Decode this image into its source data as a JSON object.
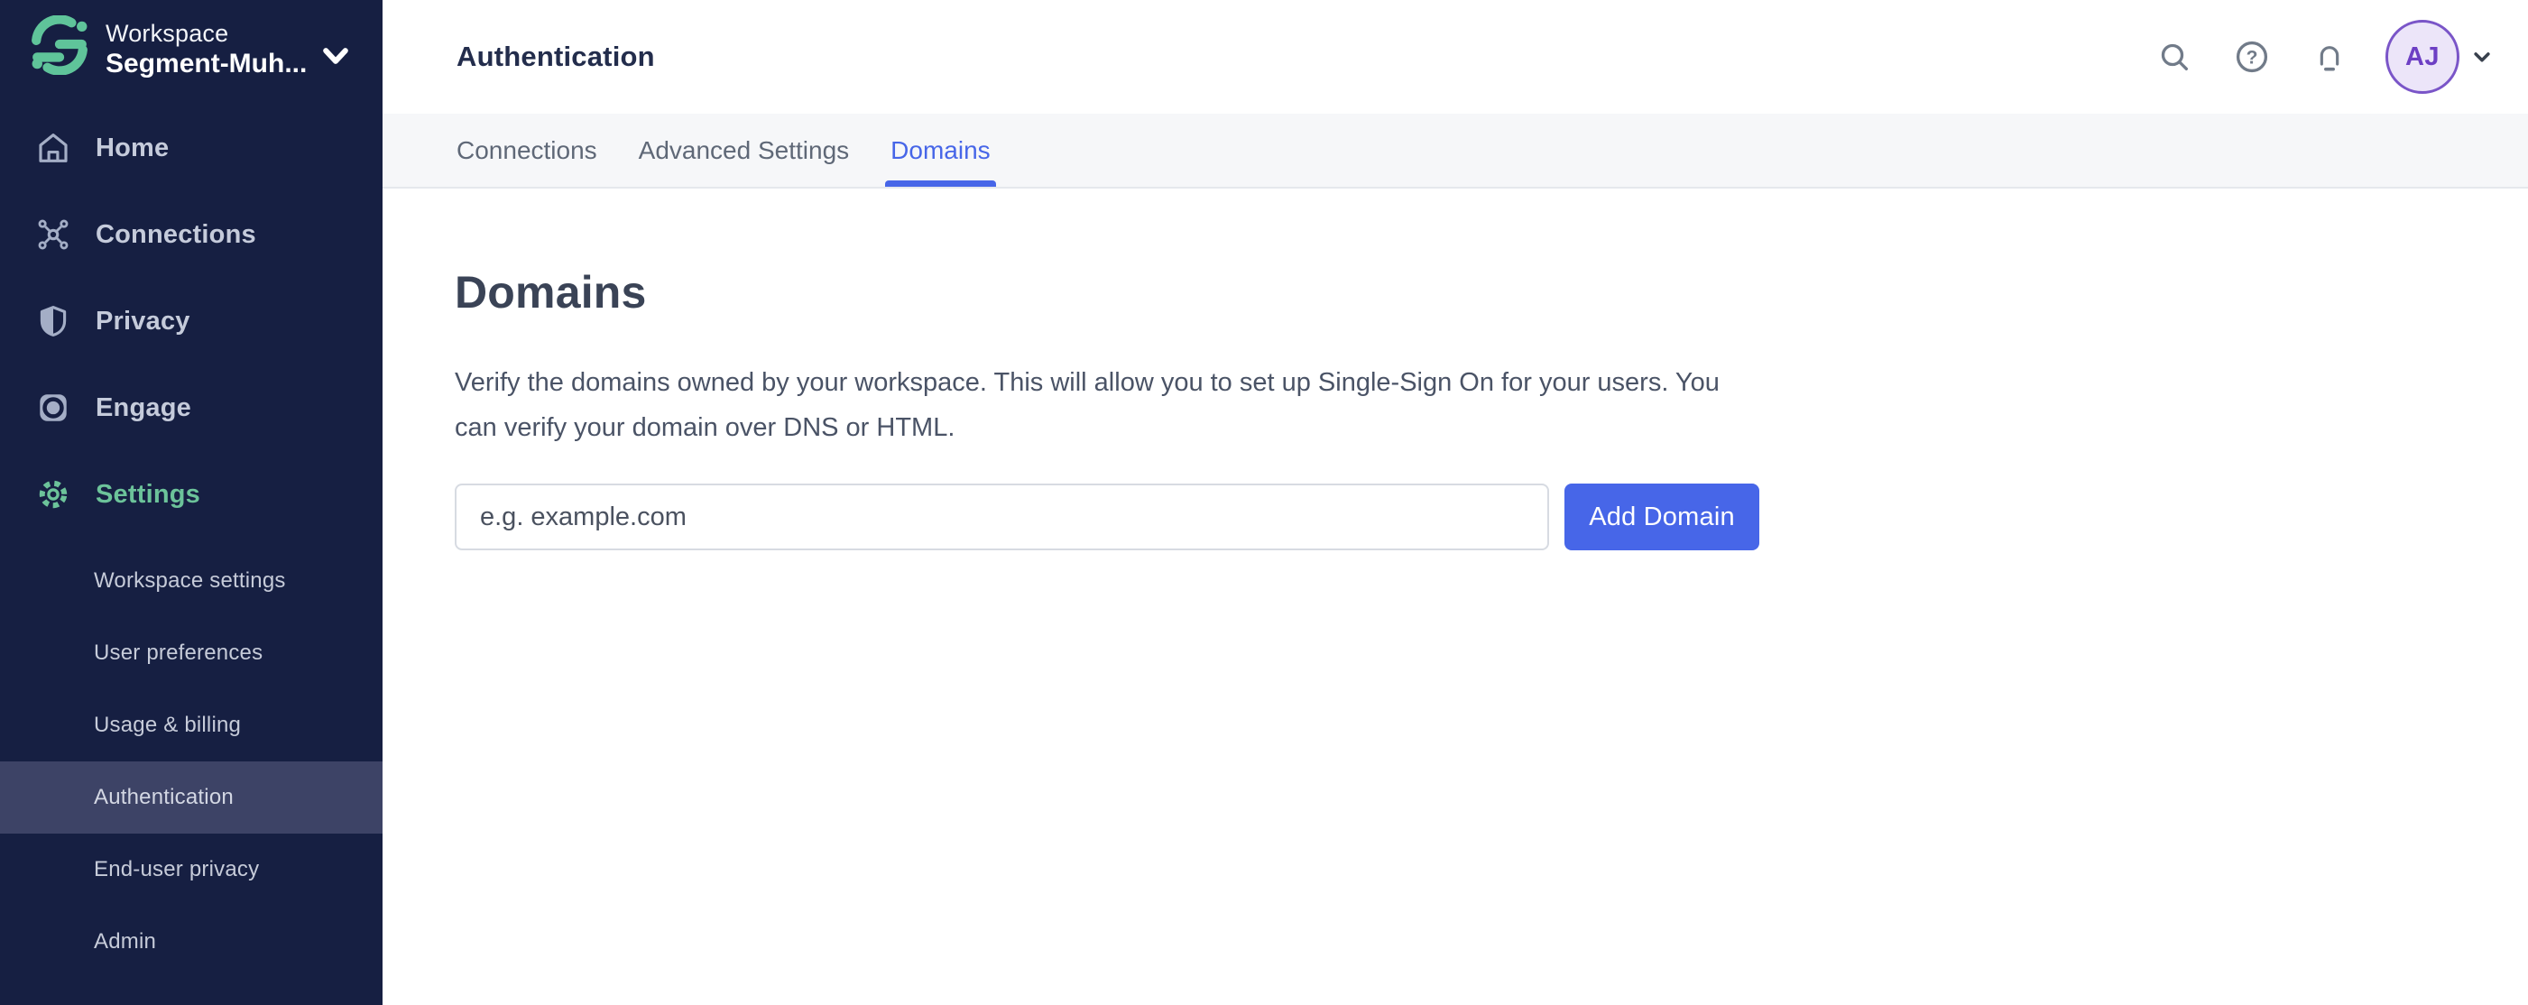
{
  "workspace": {
    "label": "Workspace",
    "name": "Segment-Muh..."
  },
  "sidebar": {
    "items": [
      {
        "label": "Home",
        "icon": "home-icon"
      },
      {
        "label": "Connections",
        "icon": "connections-icon"
      },
      {
        "label": "Privacy",
        "icon": "shield-icon"
      },
      {
        "label": "Engage",
        "icon": "engage-icon"
      },
      {
        "label": "Settings",
        "icon": "gear-icon",
        "active": true
      }
    ],
    "subitems": [
      {
        "label": "Workspace settings"
      },
      {
        "label": "User preferences"
      },
      {
        "label": "Usage & billing"
      },
      {
        "label": "Authentication",
        "active": true
      },
      {
        "label": "End-user privacy"
      },
      {
        "label": "Admin"
      }
    ]
  },
  "header": {
    "title": "Authentication",
    "tabs": [
      {
        "label": "Connections"
      },
      {
        "label": "Advanced Settings"
      },
      {
        "label": "Domains",
        "active": true
      }
    ],
    "action_icons": [
      "search-icon",
      "help-icon",
      "bell-icon"
    ]
  },
  "user": {
    "initials": "AJ"
  },
  "icons": {
    "help_glyph": "?"
  },
  "content": {
    "heading": "Domains",
    "description": "Verify the domains owned by your workspace. This will allow you to set up Single-Sign On for your users. You can verify your domain over DNS or HTML.",
    "domain_input_placeholder": "e.g. example.com",
    "add_domain_button": "Add Domain"
  },
  "colors": {
    "sidebar_bg": "#161f42",
    "sidebar_active_bg": "#3d4366",
    "accent_green": "#5fc49a",
    "accent_blue": "#4766e8",
    "tab_active": "#4766e8",
    "avatar_border": "#7a55c8",
    "avatar_bg": "#ece5f9",
    "avatar_text": "#6d3fc4"
  }
}
